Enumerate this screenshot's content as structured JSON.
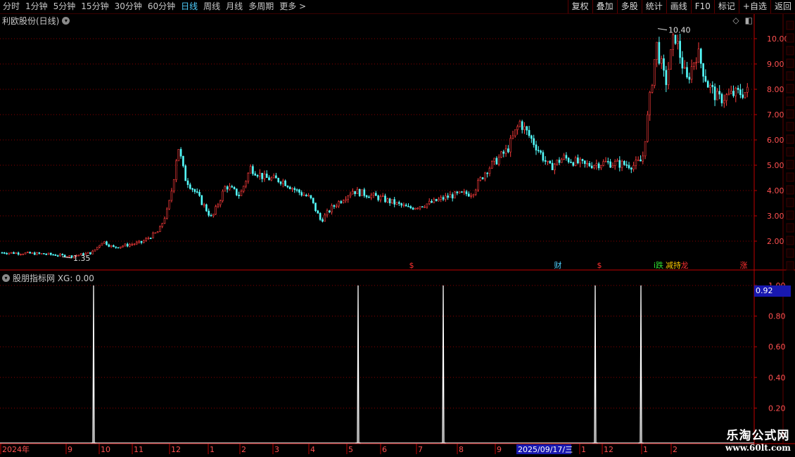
{
  "toolbar": {
    "left_items": [
      "分时",
      "1分钟",
      "5分钟",
      "15分钟",
      "30分钟",
      "60分钟",
      "日线",
      "周线",
      "月线",
      "多周期",
      "更多 >"
    ],
    "active_item": "日线",
    "right_buttons": [
      "复权",
      "叠加",
      "多股",
      "统计",
      "画线",
      "F10",
      "标记",
      "+自选",
      "返回"
    ]
  },
  "main_chart": {
    "title": "利欧股份(日线)",
    "high_label": "10.40",
    "low_label": "1.35",
    "y_ticks": [
      "10.00",
      "9.00",
      "8.00",
      "7.00",
      "6.00",
      "5.00",
      "4.00",
      "3.00",
      "2.00"
    ],
    "markers": [
      {
        "label": "$",
        "color": "#ff3030"
      },
      {
        "label": "财",
        "color": "#4fd0ff"
      },
      {
        "label": "$",
        "color": "#ff3030"
      },
      {
        "label": "i跌",
        "color": "#30e030"
      },
      {
        "label": "减持",
        "color": "#ffcc00"
      },
      {
        "label": "龙",
        "color": "#ff3030"
      },
      {
        "label": "涨",
        "color": "#ff3030"
      }
    ]
  },
  "indicator": {
    "title": "股朋指标网 XG: 0.00",
    "y_ticks": [
      "1.00",
      "0.80",
      "0.60",
      "0.40",
      "0.20"
    ],
    "current_value": "0.92"
  },
  "chart_data": {
    "type": "line",
    "title": "股朋指标网 XG: 0.00",
    "xlabel": "",
    "ylabel": "",
    "ylim": [
      0,
      1
    ],
    "x": [
      "2024-10",
      "2025-05",
      "2025-08",
      "2025-12",
      "2026-01"
    ],
    "series": [
      {
        "name": "XG",
        "values": [
          1,
          1,
          1,
          1,
          1
        ]
      }
    ]
  },
  "x_axis": {
    "labels": [
      "2024年",
      "9",
      "10",
      "11",
      "12",
      "1",
      "2",
      "3",
      "4",
      "5",
      "6",
      "7",
      "8",
      "9",
      "2025/09/17/三",
      "1",
      "12",
      "1",
      "2"
    ]
  },
  "watermark": {
    "line1": "乐淘公式网",
    "line2": "www.60lt.com"
  },
  "colors": {
    "up": "#ff3c3c",
    "down": "#54fcfc",
    "grid": "#8a0000",
    "axis": "#c00000",
    "indicator": "#ffffff",
    "cursor_box": "#1818b0"
  }
}
